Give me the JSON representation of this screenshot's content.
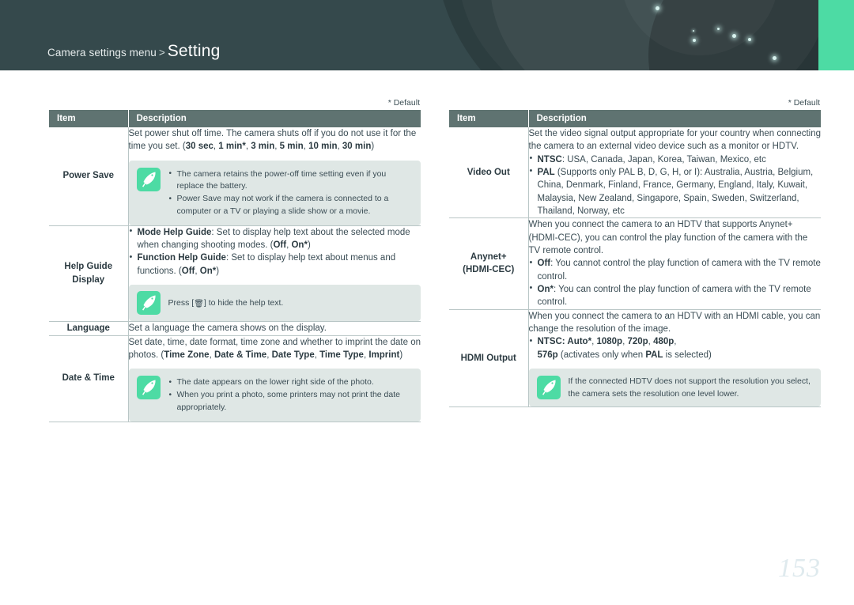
{
  "header": {
    "breadcrumb_parent": "Camera settings menu",
    "breadcrumb_separator": ">",
    "title": "Setting",
    "accent_color": "#4ddba4",
    "background_color": "#35494c"
  },
  "page_number": "153",
  "columns": {
    "left": {
      "default_note": "* Default",
      "headers": {
        "item": "Item",
        "description": "Description"
      },
      "rows": [
        {
          "item": "Power Save",
          "desc_lead_pre": "Set power shut off time. The camera shuts off if you do not use it for the time you set. (",
          "desc_lead_b1": "30 sec",
          "desc_lead_m1": ", ",
          "desc_lead_b2": "1 min*",
          "desc_lead_m2": ", ",
          "desc_lead_b3": "3 min",
          "desc_lead_m3": ", ",
          "desc_lead_b4": "5 min",
          "desc_lead_m4": ", ",
          "desc_lead_b5": "10 min",
          "desc_lead_m5": ", ",
          "desc_lead_b6": "30 min",
          "desc_lead_post": ")",
          "note_items": [
            "The camera retains the power-off time setting even if you replace the battery.",
            "Power Save may not work if the camera is connected to a computer or a TV or playing a slide show or a movie."
          ]
        },
        {
          "item": "Help Guide Display",
          "bullet1_label": "Mode Help Guide",
          "bullet1_text": ": Set to display help text about the selected mode when changing shooting modes. (",
          "bullet1_opt1": "Off",
          "bullet1_sep": ", ",
          "bullet1_opt2": "On*",
          "bullet1_close": ")",
          "bullet2_label": "Function Help Guide",
          "bullet2_text": ": Set to display help text about menus and functions. (",
          "bullet2_opt1": "Off",
          "bullet2_sep": ", ",
          "bullet2_opt2": "On*",
          "bullet2_close": ")",
          "note_press_pre": "Press [",
          "note_press_key": "trash-icon",
          "note_press_post": "] to hide the help text."
        },
        {
          "item": "Language",
          "desc": "Set a language the camera shows on the display."
        },
        {
          "item": "Date & Time",
          "desc_lead_pre": "Set date, time, date format, time zone and whether to imprint the date on photos. (",
          "desc_lead_b1": "Time Zone",
          "desc_lead_m1": ", ",
          "desc_lead_b2": "Date & Time",
          "desc_lead_m2": ", ",
          "desc_lead_b3": "Date Type",
          "desc_lead_m3": ", ",
          "desc_lead_b4": "Time Type",
          "desc_lead_m4": ", ",
          "desc_lead_b5": "Imprint",
          "desc_lead_post": ")",
          "note_items": [
            "The date appears on the lower right side of the photo.",
            "When you print a photo, some printers may not print the date appropriately."
          ]
        }
      ]
    },
    "right": {
      "default_note": "* Default",
      "headers": {
        "item": "Item",
        "description": "Description"
      },
      "rows": [
        {
          "item": "Video Out",
          "lead": "Set the video signal output appropriate for your country when connecting the camera to an external video device such as a monitor or HDTV.",
          "b1_label": "NTSC",
          "b1_text": ": USA, Canada, Japan, Korea, Taiwan, Mexico, etc",
          "b2_label": "PAL",
          "b2_text": " (Supports only PAL B, D, G, H, or I): Australia, Austria, Belgium, China, Denmark, Finland, France, Germany, England, Italy, Kuwait, Malaysia, New Zealand, Singapore, Spain, Sweden, Switzerland, Thailand, Norway, etc"
        },
        {
          "item_line1": "Anynet+",
          "item_line2": "(HDMI-CEC)",
          "lead": "When you connect the camera to an HDTV that supports Anynet+ (HDMI-CEC), you can control the play function of the camera with the TV remote control.",
          "b1_label": "Off",
          "b1_text": ": You cannot control the play function of camera with the TV remote control.",
          "b2_label": "On*",
          "b2_text": ": You can control the play function of camera with the TV remote control."
        },
        {
          "item": "HDMI Output",
          "lead": "When you connect the camera to an HDTV with an HDMI cable, you can change the resolution of the image.",
          "b1_label": "NTSC: Auto*",
          "b1_m1": ", ",
          "b1_o2": "1080p",
          "b1_m2": ", ",
          "b1_o3": "720p",
          "b1_m3": ", ",
          "b1_o4": "480p",
          "b1_m4": ",",
          "b1_o5": "576p",
          "b1_tail_pre": " (activates only when ",
          "b1_tail_b": "PAL",
          "b1_tail_post": " is selected)",
          "note_text": "If the connected HDTV does not support the resolution you select, the camera sets the resolution one level lower."
        }
      ]
    }
  }
}
